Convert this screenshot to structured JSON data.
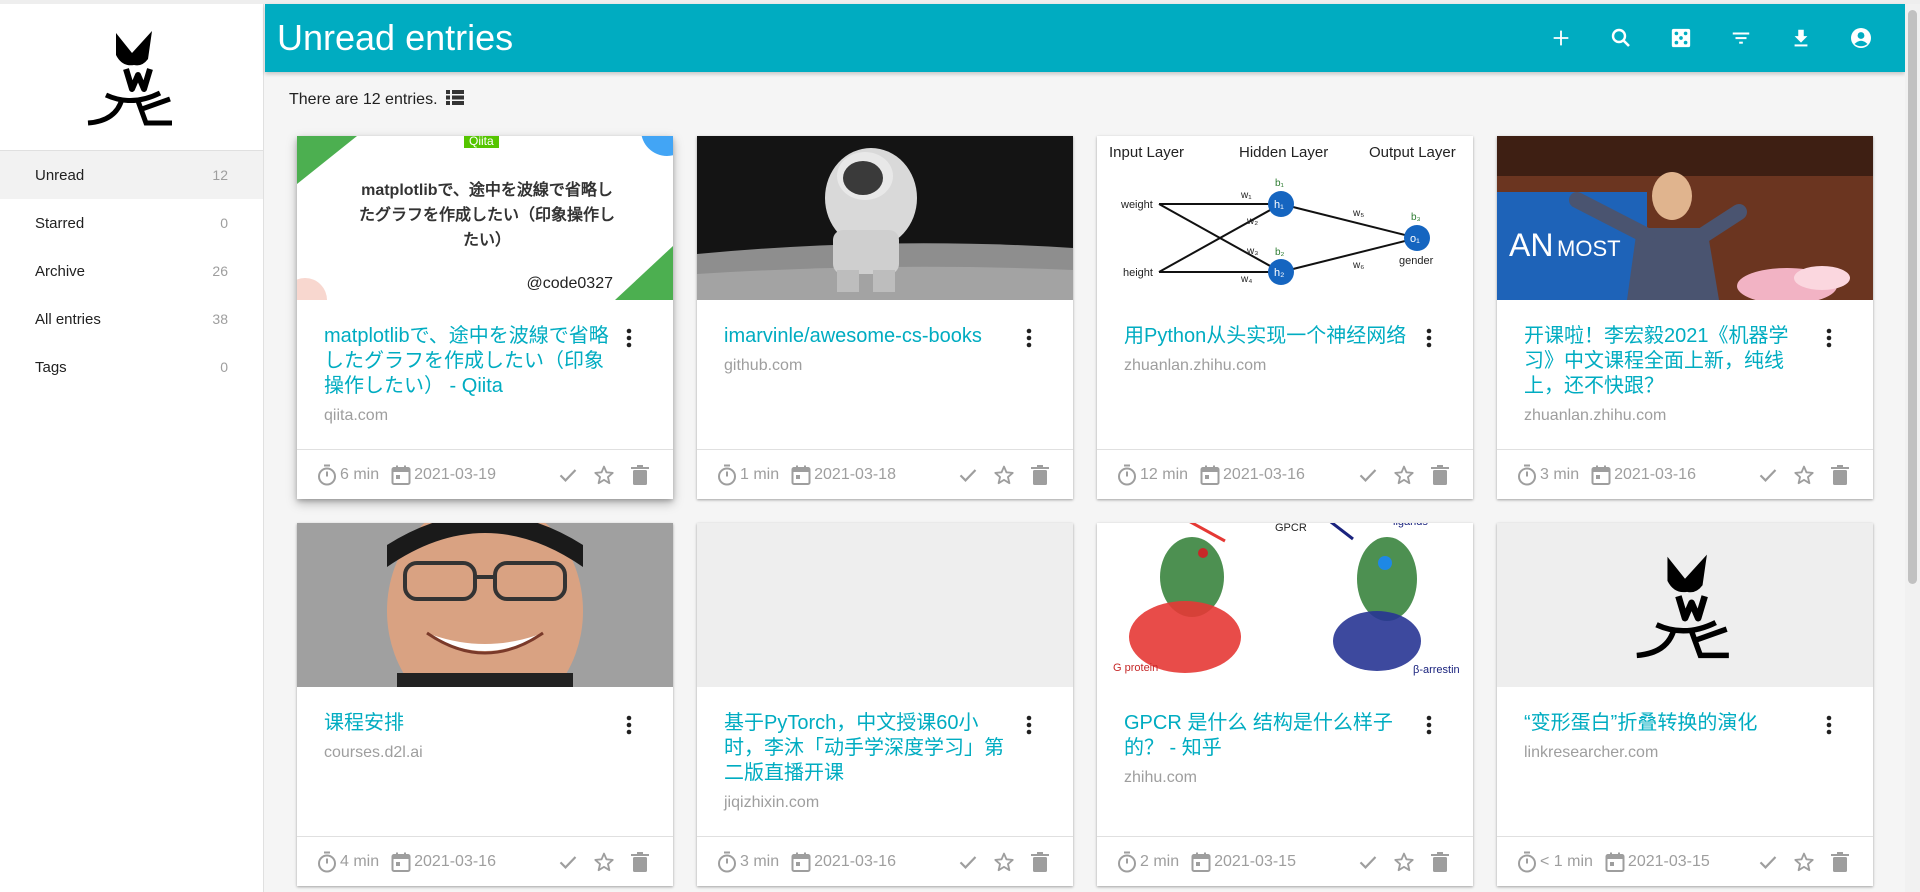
{
  "header": {
    "title": "Unread entries"
  },
  "entries_info": {
    "text": "There are 12 entries."
  },
  "sidebar": {
    "items": [
      {
        "label": "Unread",
        "count": "12"
      },
      {
        "label": "Starred",
        "count": "0"
      },
      {
        "label": "Archive",
        "count": "26"
      },
      {
        "label": "All entries",
        "count": "38"
      },
      {
        "label": "Tags",
        "count": "0"
      }
    ]
  },
  "header_icons": [
    "add-icon",
    "search-icon",
    "random-dice-icon",
    "filter-icon",
    "download-icon",
    "account-icon"
  ],
  "thumbs": {
    "qiita": {
      "label": "Qiita",
      "text": "matplotlibで、途中を波線で省略したグラフを作成したい（印象操作したい）",
      "handle": "@code0327"
    },
    "nn": {
      "input_layer": "Input Layer",
      "hidden_layer": "Hidden Layer",
      "output_layer": "Output Layer",
      "weight": "weight",
      "height": "height",
      "gender": "gender",
      "h1": "h₁",
      "h2": "h₂",
      "o1": "o₁",
      "b1": "b₁",
      "b2": "b₂",
      "b3": "b₃",
      "w1": "w₁",
      "w2": "w₂",
      "w3": "w₃",
      "w4": "w₄",
      "w5": "w₅",
      "w6": "w₆"
    },
    "gpcr": {
      "gpcr": "GPCR",
      "ligands": "ligands",
      "g_protein": "G protein",
      "arrestin": "β-arrestin"
    },
    "conf": {
      "banner_a": "AN",
      "banner_b": "MOST"
    }
  },
  "entries": [
    {
      "title": "matplotlibで、途中を波線で省略したグラフを作成したい（印象操作したい） - Qiita",
      "domain": "qiita.com",
      "reading_time": "6 min",
      "date": "2021-03-19"
    },
    {
      "title": "imarvinle/awesome-cs-books",
      "domain": "github.com",
      "reading_time": "1 min",
      "date": "2021-03-18"
    },
    {
      "title": "用Python从头实现一个神经网络",
      "domain": "zhuanlan.zhihu.com",
      "reading_time": "12 min",
      "date": "2021-03-16"
    },
    {
      "title": "开课啦！李宏毅2021《机器学习》中文课程全面上新，纯线上，还不快跟？",
      "domain": "zhuanlan.zhihu.com",
      "reading_time": "3 min",
      "date": "2021-03-16"
    },
    {
      "title": "课程安排",
      "domain": "courses.d2l.ai",
      "reading_time": "4 min",
      "date": "2021-03-16"
    },
    {
      "title": "基于PyTorch，中文授课60小时，李沐「动手学深度学习」第二版直播开课",
      "domain": "jiqizhixin.com",
      "reading_time": "3 min",
      "date": "2021-03-16"
    },
    {
      "title": "GPCR 是什么 结构是什么样子的？ - 知乎",
      "domain": "zhihu.com",
      "reading_time": "2 min",
      "date": "2021-03-15"
    },
    {
      "title": "“变形蛋白”折叠转换的演化",
      "domain": "linkresearcher.com",
      "reading_time": "< 1 min",
      "date": "2021-03-15"
    }
  ]
}
